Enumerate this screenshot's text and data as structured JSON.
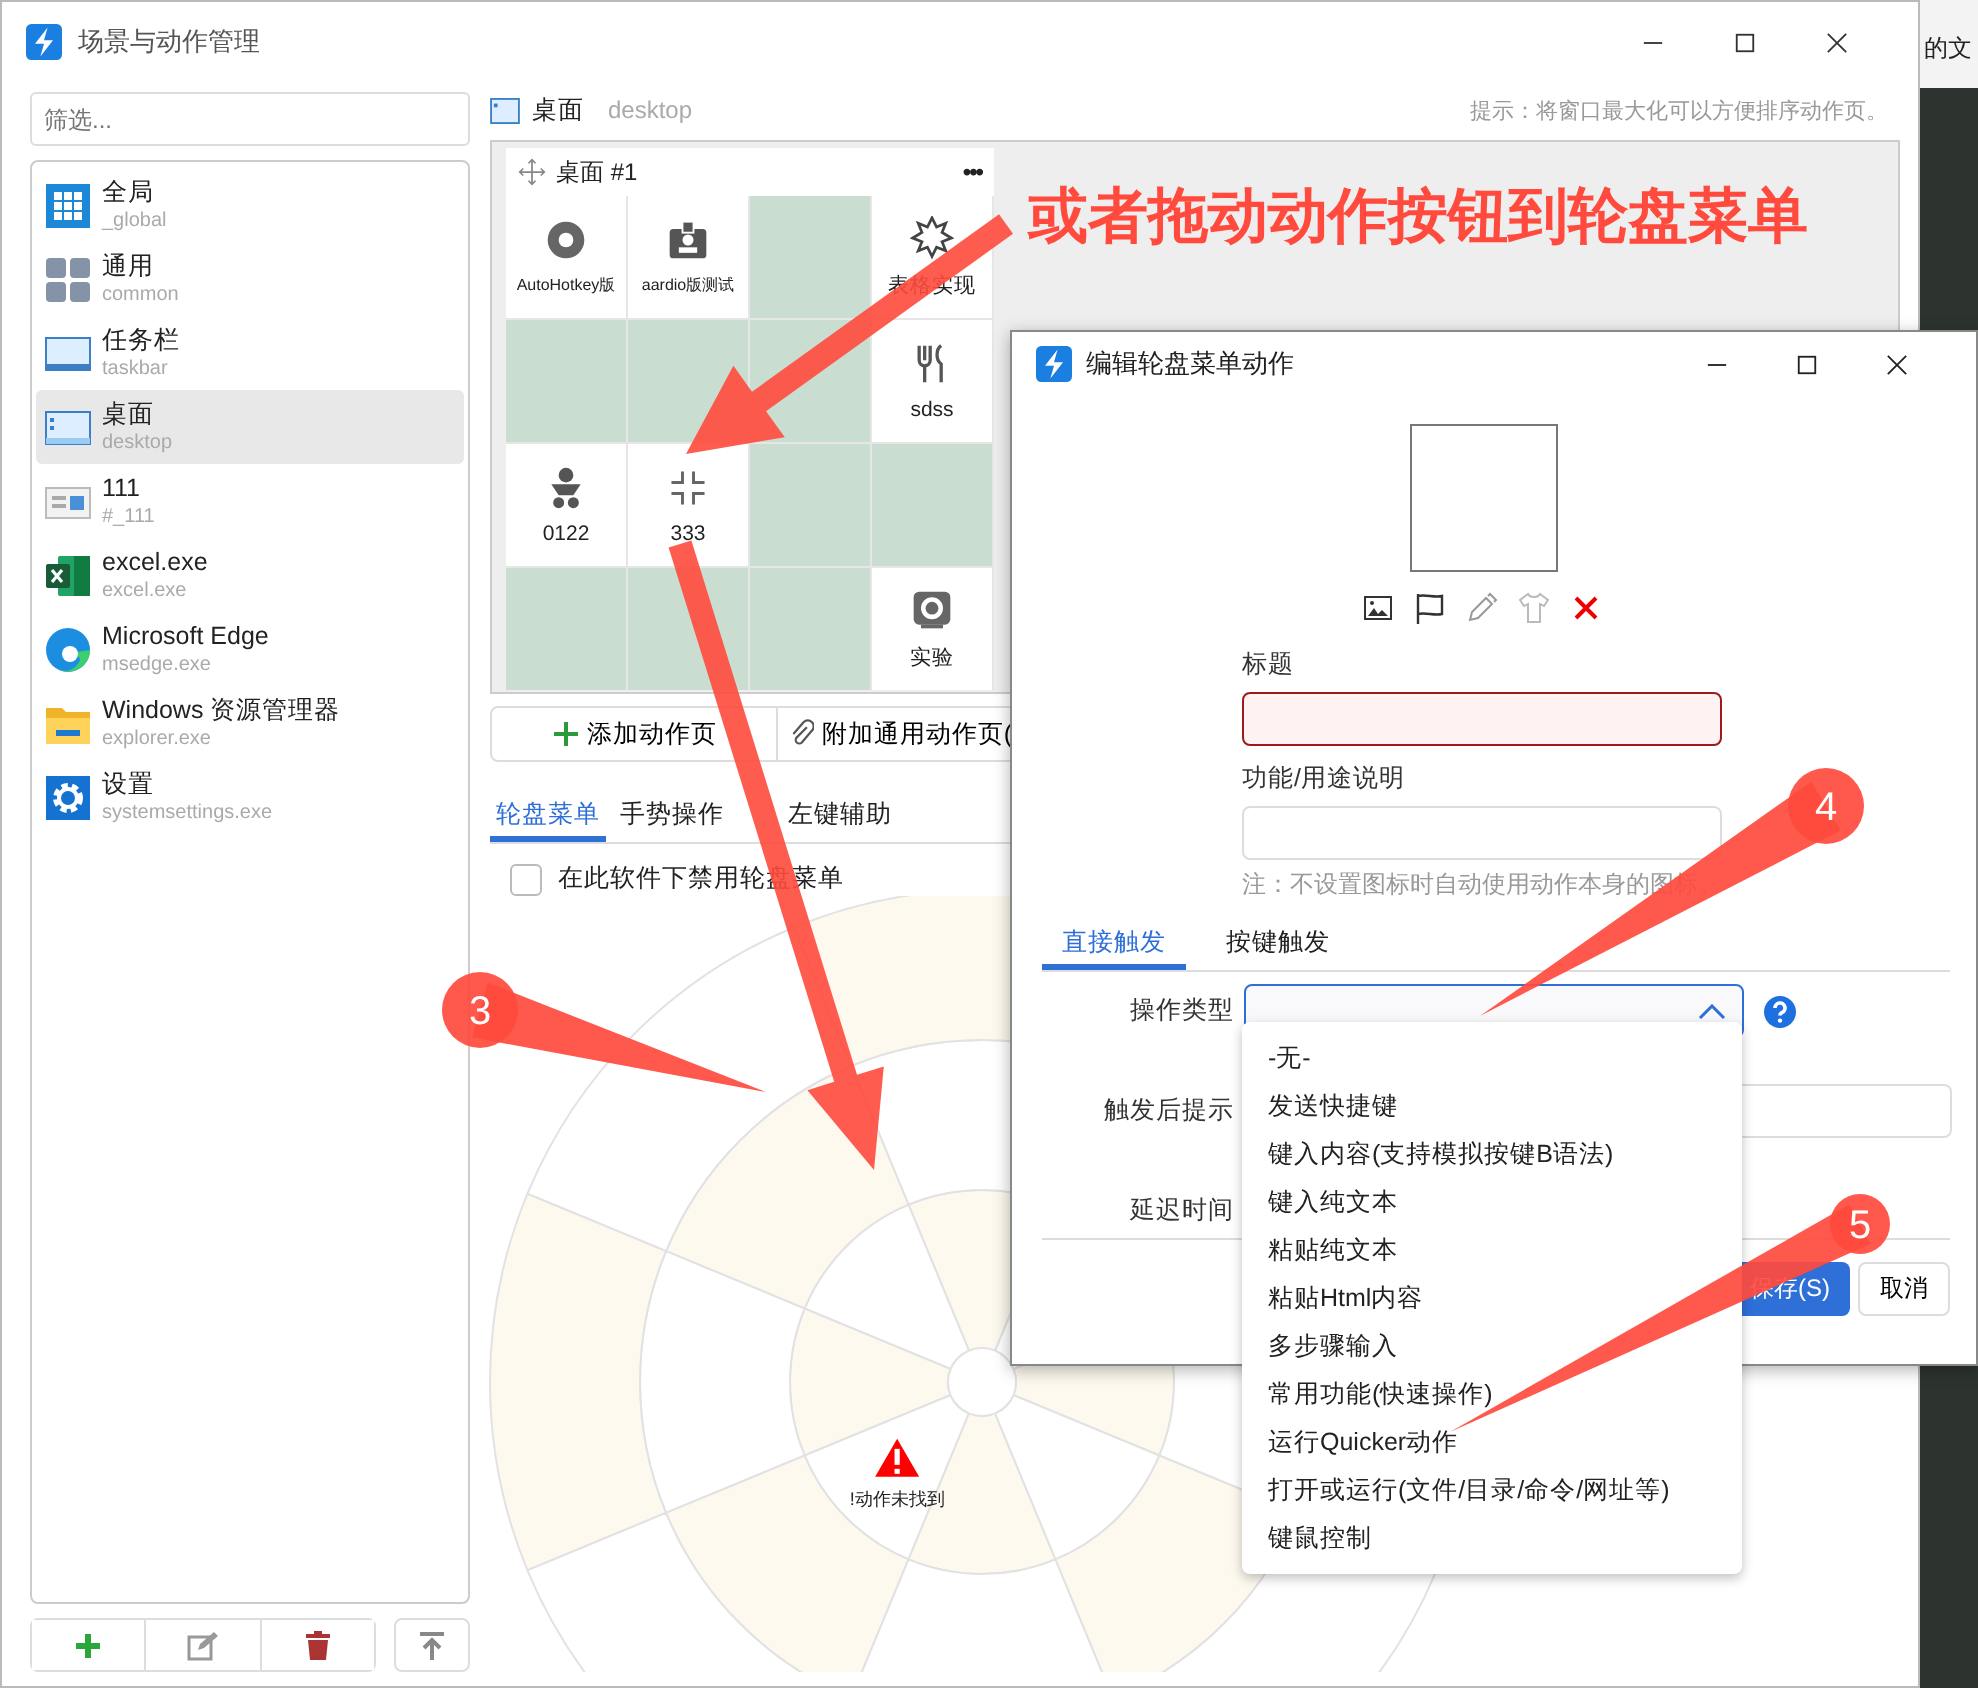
{
  "desktop": {
    "background_text": "的文"
  },
  "window": {
    "title": "场景与动作管理"
  },
  "sidebar": {
    "filter": {
      "placeholder": "筛选..."
    },
    "items": [
      {
        "label": "全局",
        "sublabel": "_global",
        "selected": false
      },
      {
        "label": "通用",
        "sublabel": "common",
        "selected": false
      },
      {
        "label": "任务栏",
        "sublabel": "taskbar",
        "selected": false
      },
      {
        "label": "桌面",
        "sublabel": "desktop",
        "selected": true
      },
      {
        "label": "111",
        "sublabel": "#_111",
        "selected": false
      },
      {
        "label": "excel.exe",
        "sublabel": "excel.exe",
        "selected": false
      },
      {
        "label": "Microsoft Edge",
        "sublabel": "msedge.exe",
        "selected": false
      },
      {
        "label": "Windows 资源管理器",
        "sublabel": "explorer.exe",
        "selected": false
      },
      {
        "label": "设置",
        "sublabel": "systemsettings.exe",
        "selected": false
      }
    ]
  },
  "page_header": {
    "title": "桌面",
    "subtitle": "desktop",
    "hint": "提示：将窗口最大化可以方便排序动作页。"
  },
  "action_page": {
    "title": "桌面 #1",
    "more": "•••",
    "cells": [
      {
        "kind": "action",
        "label": "AutoHotkey版"
      },
      {
        "kind": "action",
        "label": "aardio版测试"
      },
      {
        "kind": "empty"
      },
      {
        "kind": "action",
        "label": "表格实现"
      },
      {
        "kind": "empty"
      },
      {
        "kind": "empty"
      },
      {
        "kind": "empty"
      },
      {
        "kind": "action",
        "label": "sdss"
      },
      {
        "kind": "action",
        "label": "0122"
      },
      {
        "kind": "action",
        "label": "333"
      },
      {
        "kind": "empty"
      },
      {
        "kind": "empty"
      },
      {
        "kind": "empty"
      },
      {
        "kind": "empty"
      },
      {
        "kind": "empty"
      },
      {
        "kind": "action",
        "label": "实验"
      }
    ]
  },
  "page_buttons": [
    {
      "label": "添加动作页"
    },
    {
      "label": "附加通用动作页("
    }
  ],
  "tabs": [
    {
      "label": "轮盘菜单",
      "selected": true
    },
    {
      "label": "手势操作",
      "selected": false
    },
    {
      "label": "左键辅助",
      "selected": false
    }
  ],
  "disable_checkbox": {
    "label": "在此软件下禁用轮盘菜单",
    "checked": false
  },
  "wheel": {
    "warning_label": "!动作未找到"
  },
  "dialog": {
    "title": "编辑轮盘菜单动作",
    "title_label": "标题",
    "title_invalid": true,
    "description_label": "功能/用途说明",
    "note": "注：不设置图标时自动使用动作本身的图标。",
    "tabs": [
      {
        "label": "直接触发",
        "selected": true
      },
      {
        "label": "按键触发",
        "selected": false
      }
    ],
    "fields": [
      {
        "label": "操作类型",
        "kind": "combo",
        "expanded": true
      },
      {
        "label": "触发后提示",
        "kind": "text"
      },
      {
        "label": "延迟时间",
        "kind": "blank"
      }
    ],
    "dropdown_options": [
      "-无-",
      "发送快捷键",
      "键入内容(支持模拟按键B语法)",
      "键入纯文本",
      "粘贴纯文本",
      "粘贴Html内容",
      "多步骤输入",
      "常用功能(快速操作)",
      "运行Quicker动作",
      "打开或运行(文件/目录/命令/网址等)",
      "键鼠控制"
    ],
    "buttons": [
      {
        "label": "保存(S)",
        "kind": "primary"
      },
      {
        "label": "取消",
        "kind": "secondary"
      }
    ]
  },
  "annotations": {
    "headline": "或者拖动动作按钮到轮盘菜单",
    "callouts": [
      "3",
      "4",
      "5"
    ]
  }
}
